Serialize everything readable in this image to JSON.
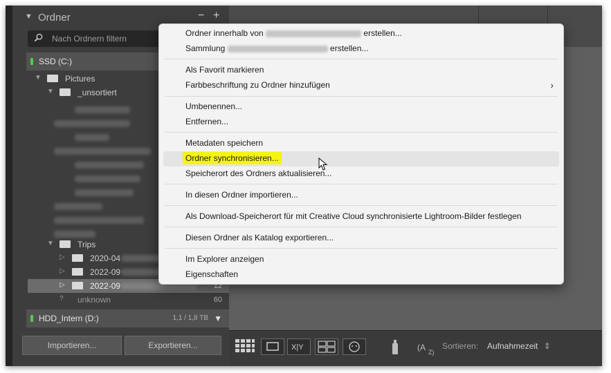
{
  "folder_panel": {
    "title": "Ordner",
    "minus": "−",
    "plus": "+",
    "filter_placeholder": "Nach Ordnern filtern",
    "volumes": [
      {
        "name": "SSD (C:)",
        "meta": ""
      },
      {
        "name": "HDD_Intern (D:)",
        "meta": "1,1 / 1,8 TB"
      }
    ],
    "tree": [
      {
        "label": "Pictures",
        "count": ""
      },
      {
        "label": "_unsortiert",
        "count": ""
      },
      {
        "label": "Trips",
        "count": ""
      },
      {
        "label": "2020-04",
        "count": ""
      },
      {
        "label": "2022-09",
        "count": ""
      },
      {
        "label": "2022-09",
        "count": "12"
      },
      {
        "label": "unknown",
        "count": "60"
      }
    ],
    "import_button": "Importieren...",
    "export_button": "Exportieren..."
  },
  "toolbar": {
    "sort_label": "Sortieren:",
    "sort_value": "Aufnahmezeit",
    "sort_arrows": "⇕"
  },
  "context_menu": {
    "items": [
      {
        "prefix": "Ordner innerhalb von",
        "suffix": "erstellen..."
      },
      {
        "prefix": "Sammlung",
        "suffix": "erstellen..."
      },
      {
        "label": "Als Favorit markieren"
      },
      {
        "label": "Farbbeschriftung zu Ordner hinzufügen",
        "submenu_arrow": "›"
      },
      {
        "label": "Umbenennen..."
      },
      {
        "label": "Entfernen..."
      },
      {
        "label": "Metadaten speichern"
      },
      {
        "label": "Ordner synchronisieren...",
        "highlighted": true
      },
      {
        "label": "Speicherort des Ordners aktualisieren..."
      },
      {
        "label": "In diesen Ordner importieren..."
      },
      {
        "label": "Als Download-Speicherort für mit Creative Cloud synchronisierte Lightroom-Bilder festlegen"
      },
      {
        "label": "Diesen Ordner als Katalog exportieren..."
      },
      {
        "label": "Im Explorer anzeigen"
      },
      {
        "label": "Eigenschaften"
      }
    ],
    "highlight_color": "#f5f50f"
  }
}
